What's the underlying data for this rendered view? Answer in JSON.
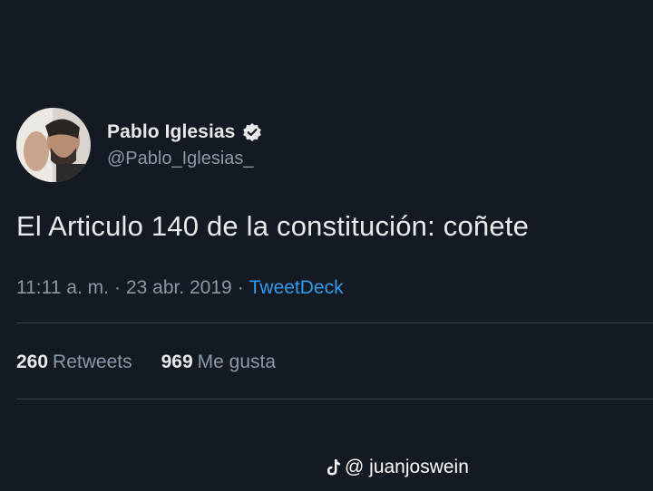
{
  "user": {
    "display_name": "Pablo Iglesias",
    "handle": "@Pablo_Iglesias_",
    "verified": true
  },
  "tweet": {
    "text": "El Articulo 140 de la constitución: coñete",
    "time": "11:11 a. m.",
    "separator": "·",
    "date": "23 abr. 2019",
    "source": "TweetDeck"
  },
  "stats": {
    "retweets_count": "260",
    "retweets_label": "Retweets",
    "likes_count": "969",
    "likes_label": "Me gusta"
  },
  "watermark": {
    "icon": "tiktok-icon",
    "text": "@ juanjoswein"
  },
  "colors": {
    "background": "#141a22",
    "text": "#e7e9ea",
    "muted": "#8b98a5",
    "link": "#2f9bf0",
    "divider": "#38444d"
  }
}
